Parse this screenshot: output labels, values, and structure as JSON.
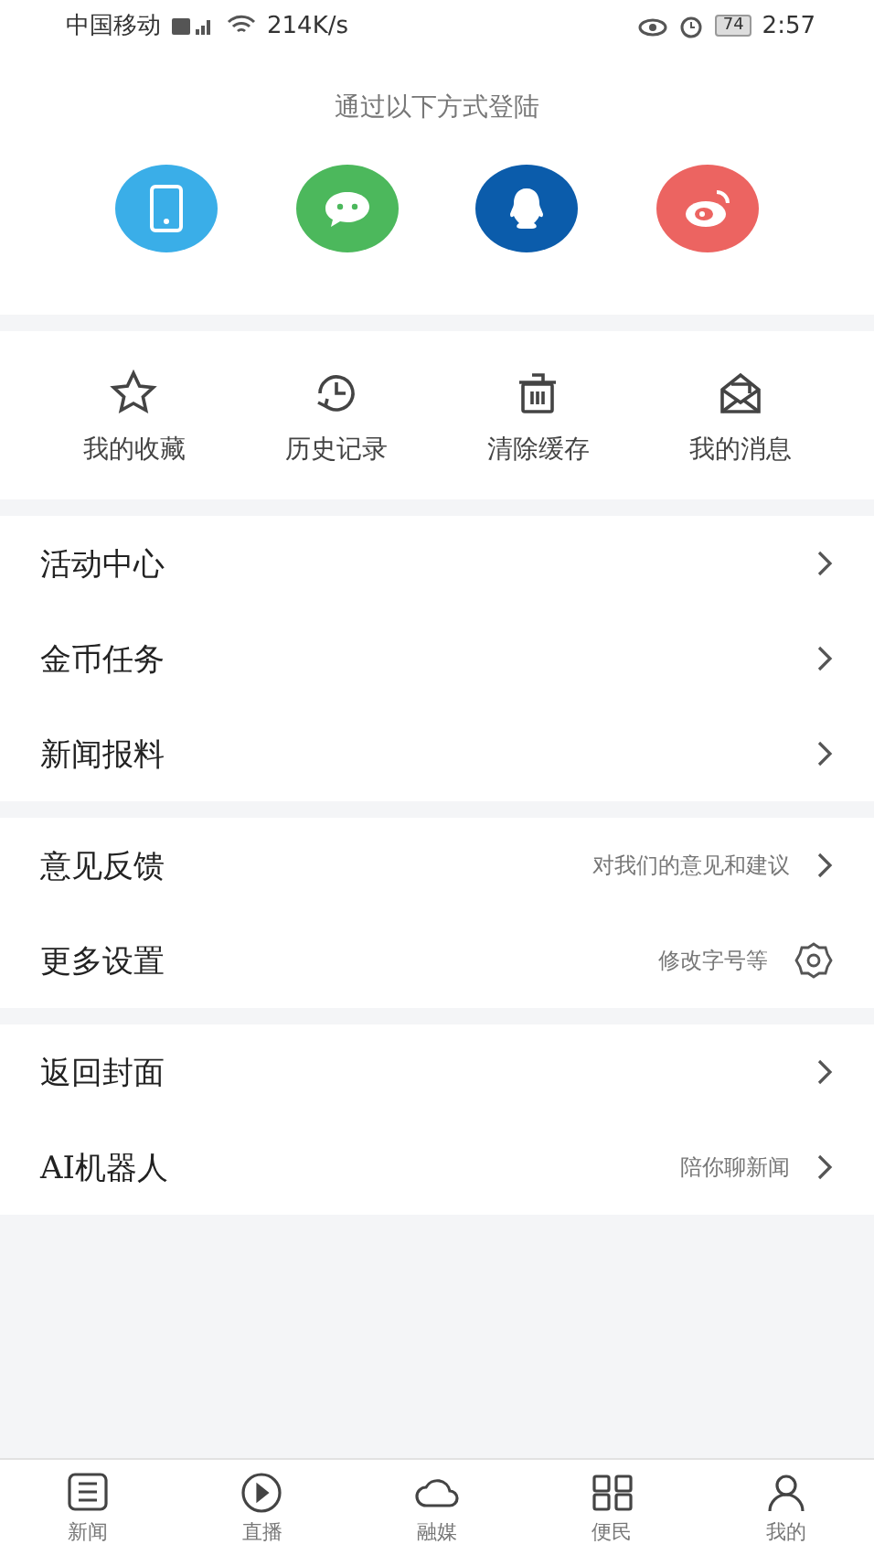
{
  "status_bar": {
    "carrier": "中国移动",
    "speed": "214K/s",
    "battery": "74",
    "time": "2:57"
  },
  "login": {
    "title": "通过以下方式登陆",
    "methods": [
      {
        "kind": "phone",
        "color": "#3aaee8"
      },
      {
        "kind": "wechat",
        "color": "#4cb85c"
      },
      {
        "kind": "qq",
        "color": "#0b5cab"
      },
      {
        "kind": "weibo",
        "color": "#ec6461"
      }
    ]
  },
  "shortcuts": [
    {
      "kind": "star",
      "label": "我的收藏"
    },
    {
      "kind": "history",
      "label": "历史记录"
    },
    {
      "kind": "trash",
      "label": "清除缓存"
    },
    {
      "kind": "mail",
      "label": "我的消息"
    }
  ],
  "menu_groups": [
    [
      {
        "label": "活动中心",
        "kind": "arrow"
      },
      {
        "label": "金币任务",
        "kind": "arrow"
      },
      {
        "label": "新闻报料",
        "kind": "arrow"
      }
    ],
    [
      {
        "label": "意见反馈",
        "hint": "对我们的意见和建议",
        "kind": "arrow"
      },
      {
        "label": "更多设置",
        "hint": "修改字号等",
        "kind": "gear"
      }
    ],
    [
      {
        "label": "返回封面",
        "kind": "arrow"
      },
      {
        "label": "AI机器人",
        "hint": "陪你聊新闻",
        "kind": "arrow"
      }
    ]
  ],
  "tab_bar": [
    {
      "kind": "list",
      "label": "新闻"
    },
    {
      "kind": "play",
      "label": "直播"
    },
    {
      "kind": "cloud",
      "label": "融媒"
    },
    {
      "kind": "grid",
      "label": "便民"
    },
    {
      "kind": "person",
      "label": "我的"
    }
  ]
}
